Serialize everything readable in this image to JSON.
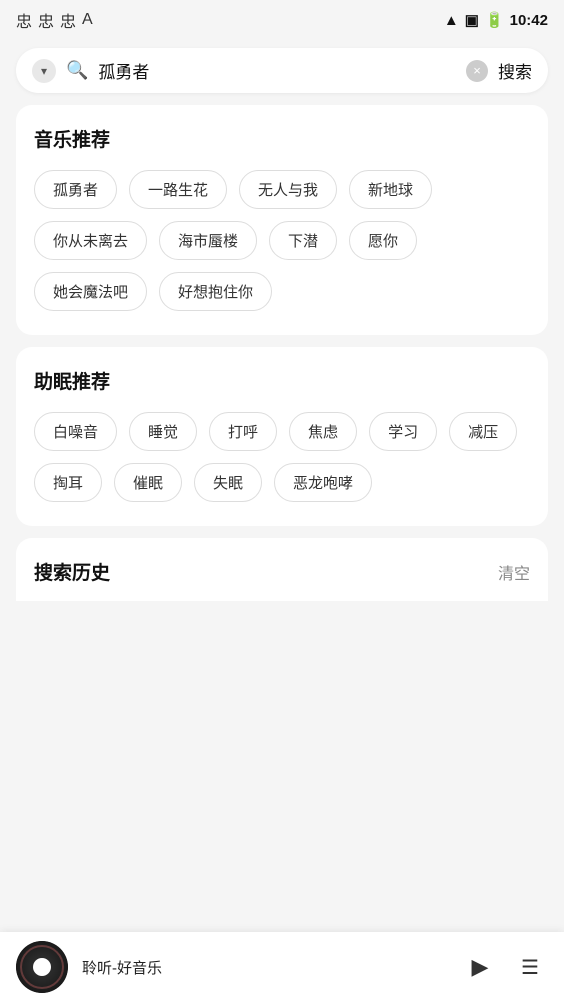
{
  "statusBar": {
    "icons": [
      "忠",
      "忠",
      "忠",
      "A"
    ],
    "time": "10:42"
  },
  "searchBar": {
    "inputValue": "孤勇者",
    "searchLabel": "搜索"
  },
  "musicSection": {
    "title": "音乐推荐",
    "tags": [
      "孤勇者",
      "一路生花",
      "无人与我",
      "新地球",
      "你从未离去",
      "海市蜃楼",
      "下潜",
      "愿你",
      "她会魔法吧",
      "好想抱住你"
    ]
  },
  "sleepSection": {
    "title": "助眠推荐",
    "tags": [
      "白噪音",
      "睡觉",
      "打呼",
      "焦虑",
      "学习",
      "减压",
      "掏耳",
      "催眠",
      "失眠",
      "恶龙咆哮"
    ]
  },
  "historySection": {
    "title": "搜索历史",
    "clearLabel": "清空"
  },
  "player": {
    "trackName": "聆听-好音乐",
    "playIcon": "▶",
    "listIcon": "☰"
  }
}
